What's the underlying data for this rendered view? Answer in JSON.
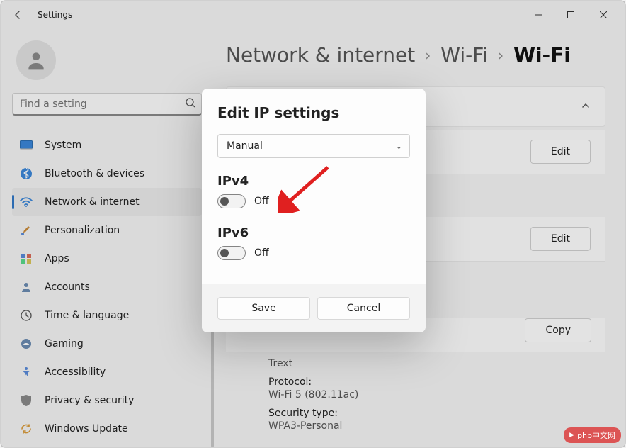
{
  "window": {
    "title": "Settings"
  },
  "search": {
    "placeholder": "Find a setting"
  },
  "nav": [
    {
      "icon": "system",
      "label": "System"
    },
    {
      "icon": "bluetooth",
      "label": "Bluetooth & devices"
    },
    {
      "icon": "wifi",
      "label": "Network & internet",
      "active": true
    },
    {
      "icon": "brush",
      "label": "Personalization"
    },
    {
      "icon": "apps",
      "label": "Apps"
    },
    {
      "icon": "account",
      "label": "Accounts"
    },
    {
      "icon": "time",
      "label": "Time & language"
    },
    {
      "icon": "gaming",
      "label": "Gaming"
    },
    {
      "icon": "accessibility",
      "label": "Accessibility"
    },
    {
      "icon": "privacy",
      "label": "Privacy & security"
    },
    {
      "icon": "update",
      "label": "Windows Update"
    }
  ],
  "breadcrumb": {
    "root": "Network & internet",
    "mid": "Wi-Fi",
    "current": "Wi-Fi"
  },
  "panel": {
    "edit1": "Edit",
    "edit2": "Edit",
    "copy": "Copy",
    "ssid_label": "Trext",
    "protocol_label": "Protocol:",
    "protocol_value": "Wi-Fi 5 (802.11ac)",
    "security_label": "Security type:",
    "security_value": "WPA3-Personal"
  },
  "dialog": {
    "title": "Edit IP settings",
    "mode": "Manual",
    "ipv4_label": "IPv4",
    "ipv4_state": "Off",
    "ipv6_label": "IPv6",
    "ipv6_state": "Off",
    "save": "Save",
    "cancel": "Cancel"
  },
  "watermark": "php中文网"
}
